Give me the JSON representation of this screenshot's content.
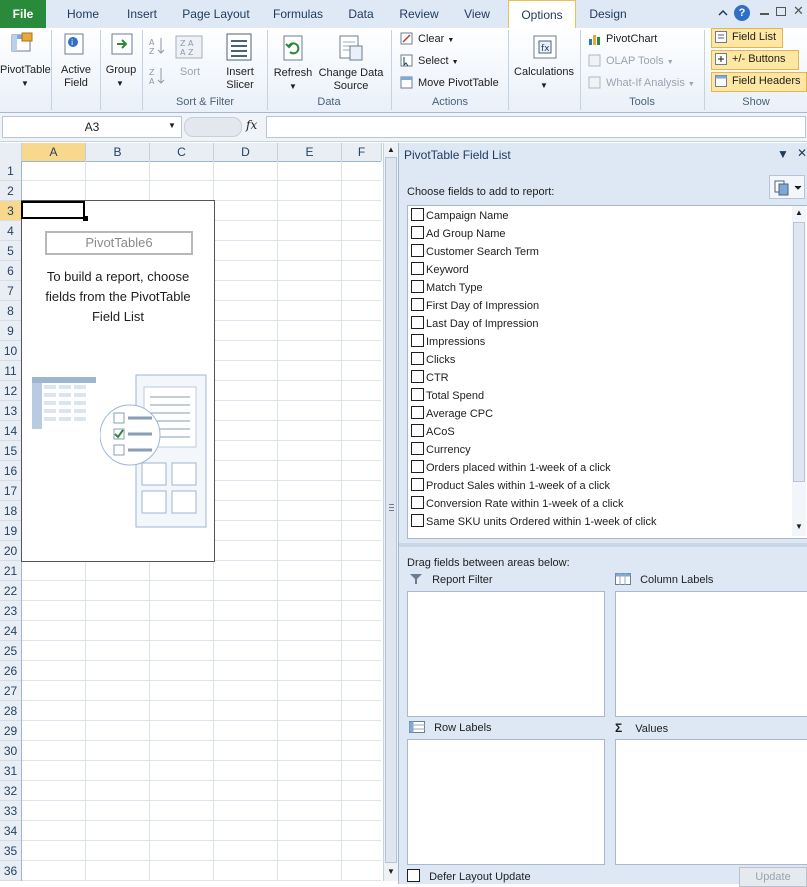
{
  "tabs": [
    {
      "label": "File"
    },
    {
      "label": "Home"
    },
    {
      "label": "Insert"
    },
    {
      "label": "Page Layout"
    },
    {
      "label": "Formulas"
    },
    {
      "label": "Data"
    },
    {
      "label": "Review"
    },
    {
      "label": "View"
    },
    {
      "label": "Options"
    },
    {
      "label": "Design"
    }
  ],
  "ribbon": {
    "pivottable": "PivotTable",
    "active_field_1": "Active",
    "active_field_2": "Field",
    "group": "Group",
    "sort": "Sort",
    "insert_slicer_1": "Insert",
    "insert_slicer_2": "Slicer",
    "refresh": "Refresh",
    "change_source_1": "Change Data",
    "change_source_2": "Source",
    "clear": "Clear",
    "select": "Select",
    "move_pivot": "Move PivotTable",
    "calculations": "Calculations",
    "pivotchart": "PivotChart",
    "olap_tools": "OLAP Tools",
    "whatif": "What-If Analysis",
    "field_list": "Field List",
    "plus_minus": "+/- Buttons",
    "field_headers": "Field Headers",
    "groups": {
      "sort_filter": "Sort & Filter",
      "data": "Data",
      "actions": "Actions",
      "tools": "Tools",
      "show": "Show"
    }
  },
  "formula_bar": {
    "name_box": "A3",
    "fx": "fx",
    "value": ""
  },
  "grid": {
    "columns": [
      "A",
      "B",
      "C",
      "D",
      "E",
      "F"
    ],
    "rows": [
      "1",
      "2",
      "3",
      "4",
      "5",
      "6",
      "7",
      "8",
      "9",
      "10",
      "11",
      "12",
      "13",
      "14",
      "15",
      "16",
      "17",
      "18",
      "19",
      "20",
      "21",
      "22",
      "23",
      "24",
      "25",
      "26",
      "27",
      "28",
      "29",
      "30",
      "31",
      "32",
      "33",
      "34",
      "35",
      "36"
    ]
  },
  "pivot": {
    "name": "PivotTable6",
    "help": "To build a report, choose fields from the PivotTable Field List"
  },
  "field_pane": {
    "title": "PivotTable Field List",
    "choose": "Choose fields to add to report:",
    "fields": [
      "Campaign Name",
      "Ad Group Name",
      "Customer Search Term",
      "Keyword",
      "Match Type",
      "First Day of Impression",
      "Last Day of Impression",
      "Impressions",
      "Clicks",
      "CTR",
      "Total Spend",
      "Average CPC",
      "ACoS",
      "Currency",
      "Orders placed within 1-week of a click",
      "Product Sales within 1-week of a click",
      "Conversion Rate within 1-week of a click",
      "Same SKU units Ordered within 1-week of click"
    ],
    "drag": "Drag fields between areas below:",
    "report_filter": "Report Filter",
    "column_labels": "Column Labels",
    "row_labels": "Row Labels",
    "values": "Values",
    "defer": "Defer Layout Update",
    "update": "Update"
  }
}
